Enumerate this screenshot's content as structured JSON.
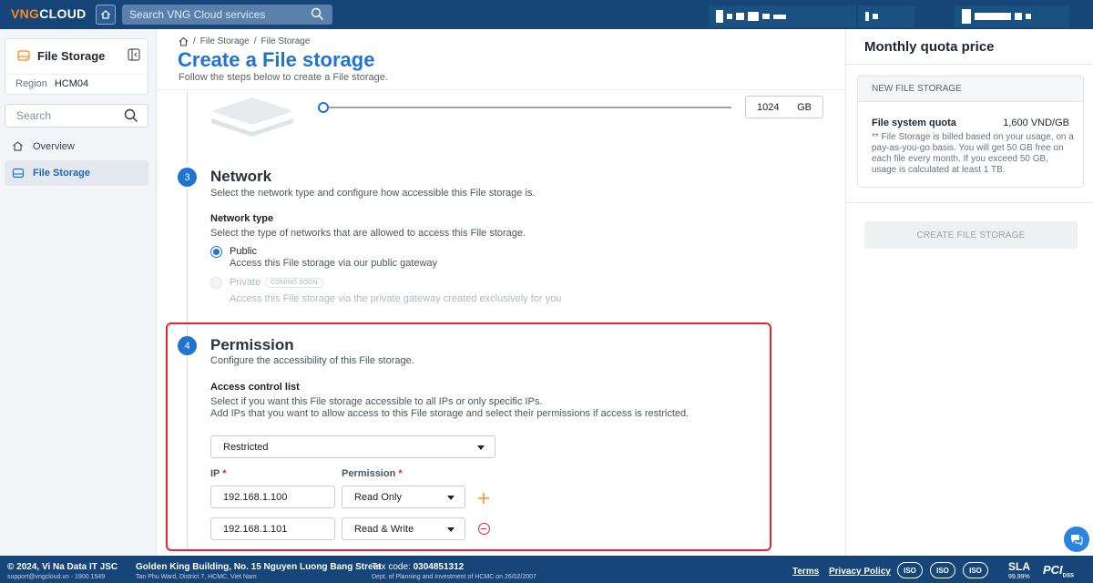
{
  "topbar": {
    "logo_part1": "VNG",
    "logo_part2": "CLOUD",
    "search_placeholder": "Search VNG Cloud services"
  },
  "sidebar": {
    "service_title": "File Storage",
    "region_label": "Region",
    "region_value": "HCM04",
    "search_placeholder": "Search",
    "items": [
      {
        "label": "Overview",
        "icon": "home-icon"
      },
      {
        "label": "File Storage",
        "icon": "file-storage-icon"
      }
    ]
  },
  "main": {
    "breadcrumb": [
      "File Storage",
      "File Storage"
    ],
    "title": "Create a File storage",
    "subtitle": "Follow the steps below to create a File storage.",
    "size": {
      "value": "1024",
      "unit": "GB"
    },
    "network": {
      "step": "3",
      "title": "Network",
      "desc": "Select the network type and configure how accessible this File storage is.",
      "field_label": "Network type",
      "help": "Select the type of networks that are allowed to access this File storage.",
      "options": [
        {
          "label": "Public",
          "desc": "Access this File storage via our public gateway"
        },
        {
          "label": "Private",
          "badge": "COMING SOON",
          "desc": "Access this File storage via the private gateway created exclusively for you"
        }
      ]
    },
    "permission": {
      "step": "4",
      "title": "Permission",
      "desc": "Configure the accessibility of this File storage.",
      "field_label": "Access control list",
      "help_line1": "Select if you want this File storage accessible to all IPs or only specific IPs.",
      "help_line2": "Add IPs that you want to allow access to this File storage and select their permissions if access is restricted.",
      "acl_value": "Restricted",
      "ip_label": "IP",
      "permission_label": "Permission",
      "required_mark": "*",
      "rows": [
        {
          "ip": "192.168.1.100",
          "permission": "Read Only"
        },
        {
          "ip": "192.168.1.101",
          "permission": "Read & Write"
        }
      ]
    }
  },
  "right_panel": {
    "title": "Monthly quota price",
    "card_header": "NEW FILE STORAGE",
    "quota_label": "File system quota",
    "quota_price": "1,600 VND/GB",
    "note": "** File Storage is billed based on your usage, on a pay-as-you-go basis. You will get 50 GB free on each file every month. If you exceed 50 GB, usage is calculated at least 1 TB.",
    "create_button": "CREATE FILE STORAGE"
  },
  "footer": {
    "company": "© 2024, Vi Na Data IT JSC",
    "support": "support@vngcloud.vn - 1900 1549",
    "address": "Golden King Building, No. 15 Nguyen Luong Bang Street",
    "address2": "Tan Phu Ward, District 7, HCMC, Viet Nam",
    "tax_label": "Tax code:",
    "tax_code": "0304851312",
    "tax_note": "Dept. of Planning and Investment of HCMC on 26/02/2007",
    "terms": "Terms",
    "privacy": "Privacy Policy",
    "badges": [
      "ISO",
      "ISO",
      "ISO"
    ],
    "sla": "SLA",
    "sla_value": "99.99%",
    "pci": "PCI",
    "pci_sub": "DSS"
  },
  "colors": {
    "brand_blue": "#16457a",
    "accent_blue": "#1f73d1",
    "highlight_red": "#e5262a",
    "plus_orange": "#f68b1f"
  }
}
